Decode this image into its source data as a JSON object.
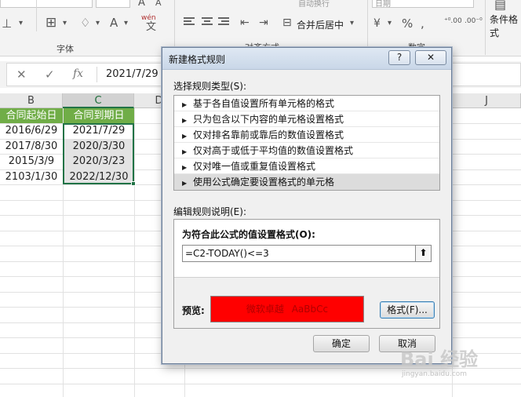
{
  "ribbon": {
    "font_group_label": "字体",
    "align_group_label": "对齐方式",
    "number_group_label": "数字",
    "merge_button_label": "合并后居中",
    "wrap_text_label": "自动换行",
    "number_format_value": "日期",
    "conditional_format_label": "条件格式",
    "percent_symbol": "%",
    "comma_symbol": ",",
    "currency_symbol": "¥",
    "phonetic_label": "wén"
  },
  "formula_bar": {
    "cancel_symbol": "✕",
    "enter_symbol": "✓",
    "fx_label": "fx",
    "value": "2021/7/29"
  },
  "columns": [
    "B",
    "C",
    "D",
    "J"
  ],
  "table": {
    "headers": [
      "合同起始日",
      "合同到期日"
    ],
    "rows": [
      [
        "2016/6/29",
        "2021/7/29"
      ],
      [
        "2017/8/30",
        "2020/3/30"
      ],
      [
        "2015/3/9",
        "2020/3/23"
      ],
      [
        "2103/1/30",
        "2022/12/30"
      ]
    ]
  },
  "dialog": {
    "title": "新建格式规则",
    "help_button": "?",
    "close_button": "✕",
    "rule_type_label": "选择规则类型(S):",
    "rule_types": [
      "基于各自值设置所有单元格的格式",
      "只为包含以下内容的单元格设置格式",
      "仅对排名靠前或靠后的数值设置格式",
      "仅对高于或低于平均值的数值设置格式",
      "仅对唯一值或重复值设置格式",
      "使用公式确定要设置格式的单元格"
    ],
    "selected_rule_index": 5,
    "edit_description_label": "编辑规则说明(E):",
    "formula_prompt": "为符合此公式的值设置格式(O):",
    "formula_value": "=C2-TODAY()<=3",
    "collapse_symbol": "⬆",
    "preview_label": "预览:",
    "preview_text_cn": "微软卓越",
    "preview_text_en": "AaBbCc",
    "preview_fill_color": "#ff0000",
    "format_button": "格式(F)...",
    "ok_button": "确定",
    "cancel_button": "取消"
  },
  "watermark": {
    "text": "Bai 经验",
    "sub": "jingyan.baidu.com"
  }
}
